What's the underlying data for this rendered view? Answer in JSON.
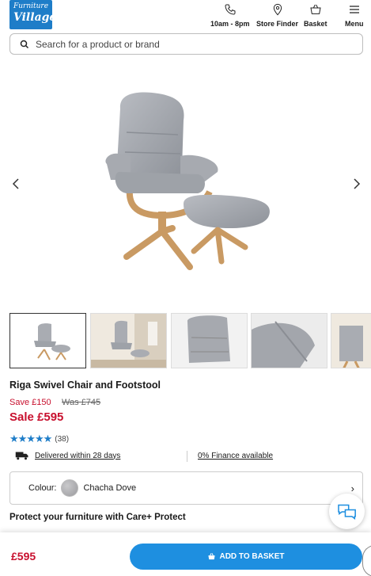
{
  "brand": {
    "line1": "Furniture",
    "line2": "Village"
  },
  "header": {
    "phone_label": "10am - 8pm",
    "store_label": "Store Finder",
    "basket_label": "Basket",
    "menu_label": "Menu"
  },
  "search": {
    "placeholder": "Search for a product or brand"
  },
  "product": {
    "title": "Riga Swivel Chair and Footstool",
    "save_text": "Save £150",
    "was_text": "Was £745",
    "sale_text": "Sale £595",
    "stars": "★★★★★",
    "review_count": "(38)",
    "rating": 4.5
  },
  "links": {
    "delivery": "Delivered within 28 days",
    "finance": "0% Finance available"
  },
  "colour": {
    "label": "Colour:",
    "value": "Chacha Dove",
    "chevron": "›"
  },
  "protect": {
    "label": "Protect your furniture with Care+ Protect"
  },
  "footer": {
    "price": "£595",
    "button_label": "ADD TO BASKET"
  },
  "colors": {
    "accent": "#1e8fe0",
    "sale": "#c8102e",
    "brand": "#1e7dc8"
  },
  "icons": [
    "phone-icon",
    "map-pin-icon",
    "basket-icon",
    "menu-icon",
    "search-icon",
    "chevron-left-icon",
    "chevron-right-icon",
    "delivery-truck-icon",
    "chat-icon"
  ]
}
